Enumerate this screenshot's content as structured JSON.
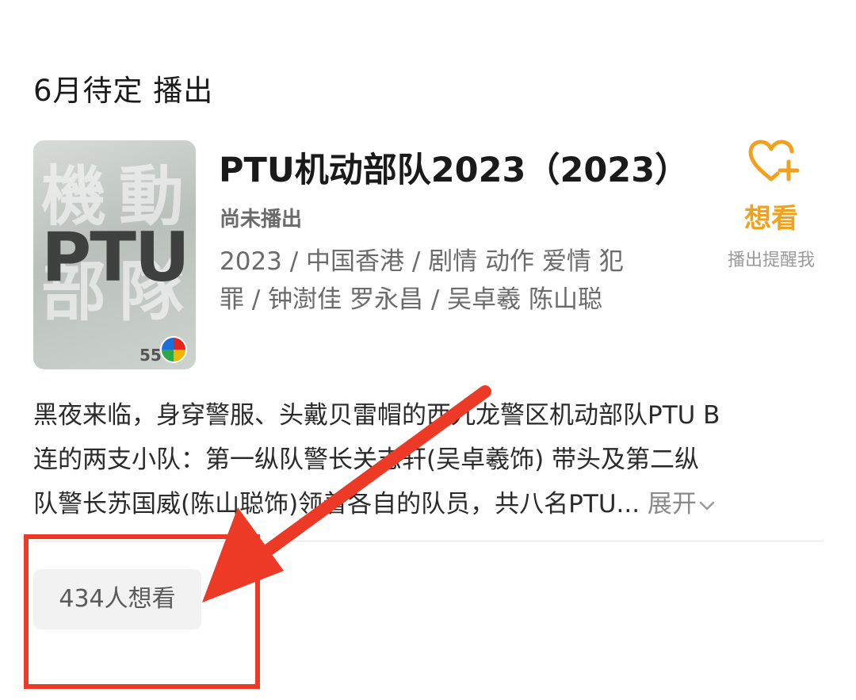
{
  "section": {
    "title": "6月待定 播出"
  },
  "show": {
    "poster": {
      "big_text": "PTU",
      "bg_chars": [
        "機",
        "動",
        "部",
        "隊"
      ],
      "logo_text": "55"
    },
    "title": "PTU机动部队2023（2023）",
    "status": "尚未播出",
    "meta_line1": "2023 / 中国香港 / 剧情 动作 爱情 犯",
    "meta_line2": "罪 / 钟澍佳 罗永昌 / 吴卓羲 陈山聪"
  },
  "want": {
    "label": "想看",
    "hint": "播出提醒我",
    "icon": "heart-plus-icon",
    "color": "#f0a21e"
  },
  "description": {
    "line1": "黑夜来临，身穿警服、头戴贝雷帽的西九龙警区机动部队PTU B",
    "line2": "连的两支小队：第一纵队警长关志轩(吴卓羲饰) 带头及第二纵",
    "line3": "队警长苏国威(陈山聪饰)领着各自的队员，共八名PTU...",
    "expand": " 展开"
  },
  "stats": {
    "want_count": "434人想看"
  },
  "annotation": {
    "color": "#ec3a26"
  }
}
